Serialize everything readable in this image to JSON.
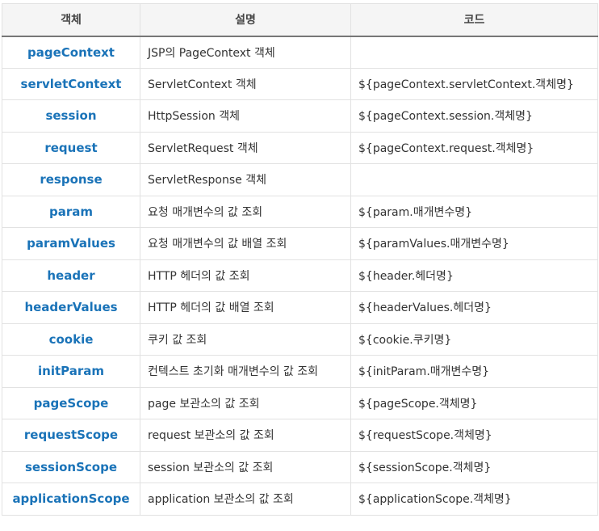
{
  "table": {
    "headers": [
      "객체",
      "설명",
      "코드"
    ],
    "rows": [
      {
        "object": "pageContext",
        "description": "JSP의 PageContext 객체",
        "code": ""
      },
      {
        "object": "servletContext",
        "description": "ServletContext 객체",
        "code": "${pageContext.servletContext.객체명}"
      },
      {
        "object": "session",
        "description": "HttpSession 객체",
        "code": "${pageContext.session.객체명}"
      },
      {
        "object": "request",
        "description": "ServletRequest 객체",
        "code": "${pageContext.request.객체명}"
      },
      {
        "object": "response",
        "description": "ServletResponse 객체",
        "code": ""
      },
      {
        "object": "param",
        "description": "요청 매개변수의 값 조회",
        "code": "${param.매개변수명}"
      },
      {
        "object": "paramValues",
        "description": "요청 매개변수의 값 배열 조회",
        "code": "${paramValues.매개변수명}"
      },
      {
        "object": "header",
        "description": "HTTP 헤더의 값 조회",
        "code": "${header.헤더명}"
      },
      {
        "object": "headerValues",
        "description": "HTTP 헤더의 값 배열 조회",
        "code": "${headerValues.헤더명}"
      },
      {
        "object": "cookie",
        "description": "쿠키 값 조회",
        "code": "${cookie.쿠키명}"
      },
      {
        "object": "initParam",
        "description": "컨텍스트 초기화 매개변수의 값 조회",
        "code": "${initParam.매개변수명}"
      },
      {
        "object": "pageScope",
        "description": "page 보관소의 값 조회",
        "code": "${pageScope.객체명}"
      },
      {
        "object": "requestScope",
        "description": "request 보관소의 값 조회",
        "code": "${requestScope.객체명}"
      },
      {
        "object": "sessionScope",
        "description": "session 보관소의 값 조회",
        "code": "${sessionScope.객체명}"
      },
      {
        "object": "applicationScope",
        "description": "application 보관소의 값 조회",
        "code": "${applicationScope.객체명}"
      }
    ]
  }
}
